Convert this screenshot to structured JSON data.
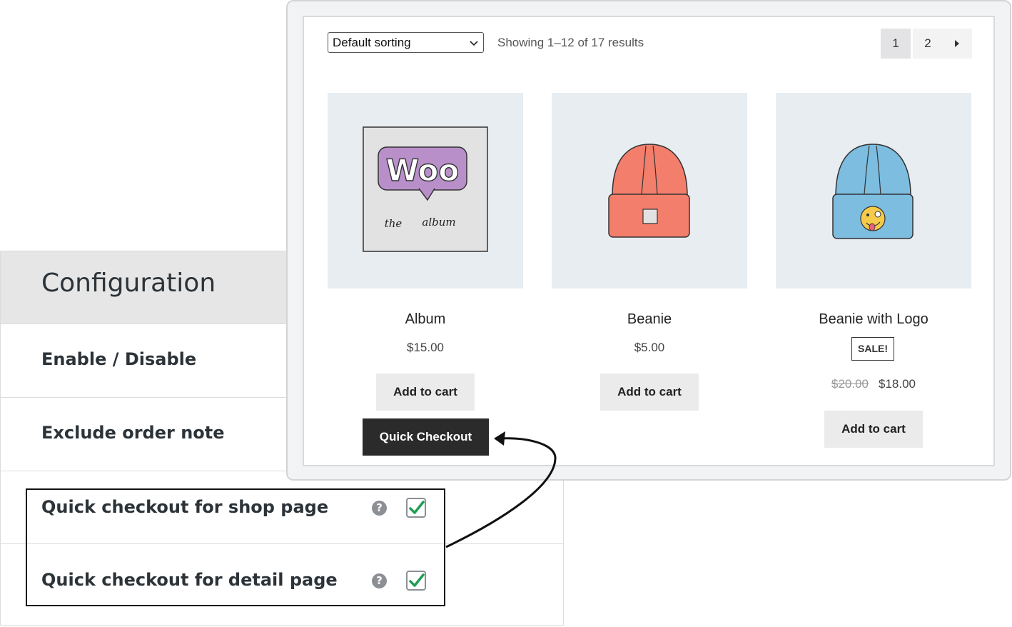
{
  "config": {
    "title": "Configuration",
    "rows": [
      {
        "label": "Enable / Disable"
      },
      {
        "label": "Exclude order note"
      },
      {
        "label": "Quick checkout for shop page",
        "help": "?",
        "checked": true
      },
      {
        "label": "Quick checkout for detail page",
        "help": "?",
        "checked": true
      }
    ]
  },
  "shop": {
    "sort": {
      "value": "Default sorting"
    },
    "result_count": "Showing 1–12 of 17 results",
    "pagination": {
      "pages": [
        "1",
        "2"
      ],
      "current": "1",
      "next_icon": "triangle-right-icon"
    },
    "products": [
      {
        "name": "Album",
        "price": "$15.00",
        "add_to_cart": "Add to cart",
        "image_text": [
          "Woo",
          "the",
          "album"
        ]
      },
      {
        "name": "Beanie",
        "price": "$5.00",
        "add_to_cart": "Add to cart"
      },
      {
        "name": "Beanie with Logo",
        "sale_badge": "SALE!",
        "old_price": "$20.00",
        "price": "$18.00",
        "add_to_cart": "Add to cart"
      }
    ],
    "quick_checkout_label": "Quick Checkout"
  },
  "colors": {
    "quick_checkout_bg": "#2b2b2b",
    "check_green": "#1f9d55",
    "album_purple": "#b98fc9",
    "beanie_orange": "#f37e6b",
    "beanie_blue": "#7dbde0",
    "product_bg": "#e8edf1"
  }
}
